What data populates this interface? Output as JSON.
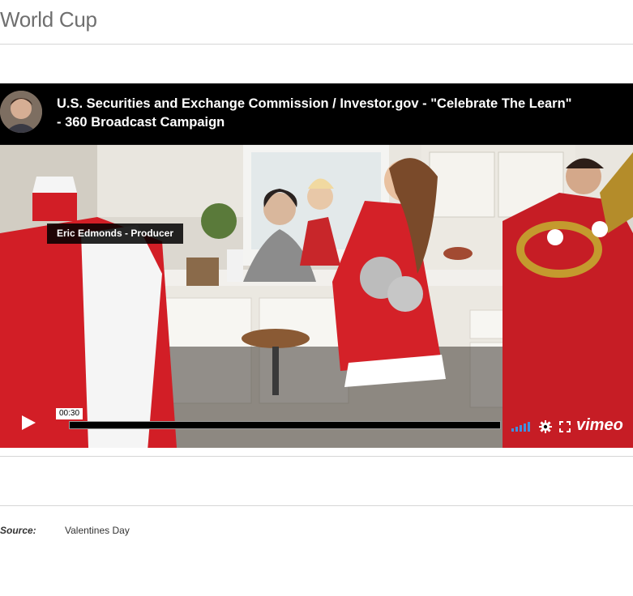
{
  "page": {
    "title": "World Cup"
  },
  "video": {
    "title": "U.S. Securities and Exchange Commission / Investor.gov - \"Celebrate The Learn\" - 360 Broadcast Campaign",
    "byline": "Eric Edmonds - Producer",
    "timecode": "00:30",
    "progress": 0.0,
    "brand": "vimeo",
    "volume_level": 1.0,
    "colors": {
      "volume": "#3f8fe0",
      "bar": "#000000",
      "overlay": "#000000"
    },
    "icons": [
      "play-icon",
      "volume-icon",
      "settings-icon",
      "fullscreen-icon",
      "vimeo-logo"
    ]
  },
  "source": {
    "label": "Source:",
    "value": "Valentines Day"
  }
}
